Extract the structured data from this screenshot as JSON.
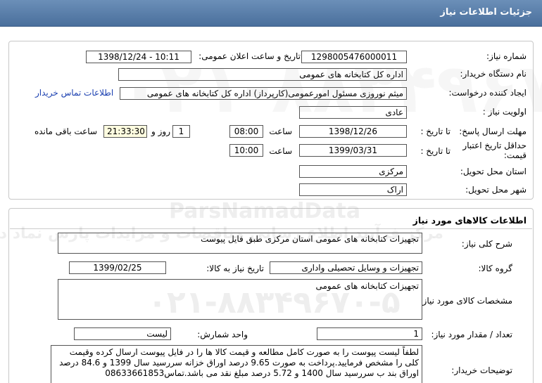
{
  "header": {
    "title": "جزئیات اطلاعات نیاز"
  },
  "need_info": {
    "need_number_label": "شماره نیاز:",
    "need_number": "1298005476000011",
    "announce_label": "تاریخ و ساعت اعلان عمومی:",
    "announce_value": "1398/12/24 - 10:11",
    "buyer_org_label": "نام دستگاه خریدار:",
    "buyer_org": "اداره کل کتابخانه های عمومی",
    "requester_label": "ایجاد کننده درخواست:",
    "requester": "میثم نوروزی مسئول امورعمومی(کارپرداز) اداره کل کتابخانه های عمومی",
    "contact_link": "اطلاعات تماس خریدار",
    "priority_label": "اولویت نیاز :",
    "priority": "عادی",
    "deadline_label": "مهلت ارسال پاسخ:",
    "to_date_label": "تا تاریخ :",
    "deadline_date": "1398/12/26",
    "time_label": "ساعت",
    "deadline_time": "08:00",
    "days_value": "1",
    "days_label": "روز و",
    "remaining_time": "21:33:30",
    "remaining_label": "ساعت باقی مانده",
    "validity_label_1": "حداقل تاریخ اعتبار",
    "validity_label_2": "قیمت:",
    "validity_date": "1399/03/31",
    "validity_time": "10:00",
    "province_label": "استان محل تحویل:",
    "province": "مرکزی",
    "city_label": "شهر محل تحویل:",
    "city": "اراک"
  },
  "goods": {
    "title": "اطلاعات کالاهای مورد نیاز",
    "summary_label": "شرح کلی نیاز:",
    "summary": "تجهیزات کتابخانه های عمومی استان مرکزی طبق فایل پیوست",
    "group_label": "گروه کالا:",
    "group": "تجهیزات و وسایل تحصیلی واداری",
    "need_date_label": "تاریخ نیاز به کالا:",
    "need_date": "1399/02/25",
    "specs_label": "مشخصات کالای مورد نیاز:",
    "specs": "تجهیزات کتابخانه های عمومی",
    "qty_label": "تعداد / مقدار مورد نیاز:",
    "qty": "1",
    "unit_label": "واحد شمارش:",
    "unit": "لیست",
    "buyer_notes_label": "توضیحات خریدار:",
    "buyer_notes": "لطفاً لیست پیوست را به صورت کامل مطالعه و قیمت کالا ها را در فایل پیوست ارسال کرده وقیمت کلی را مشخص فرمایید.پرداخت به صورت 9.65 درصد اوراق خزانه سررسید سال 1399 و 84.6 درصد اوراق بند ب سررسید سال 1400 و 5.72 درصد مبلغ نقد می باشد.تماس08633661853"
  },
  "watermark": {
    "brand": "ParsNamadData",
    "tagline": "مرکز فرآیند اطلاع رسانی مناقصات و مزایدات پارس نماد داده ها",
    "phone": "۰۲۱-۸۸۳۴۹۶۷۰-۵"
  },
  "colors": {
    "header_bg": "#5a7fab",
    "link": "#1a3fb0",
    "time_bg": "#fffde0"
  }
}
